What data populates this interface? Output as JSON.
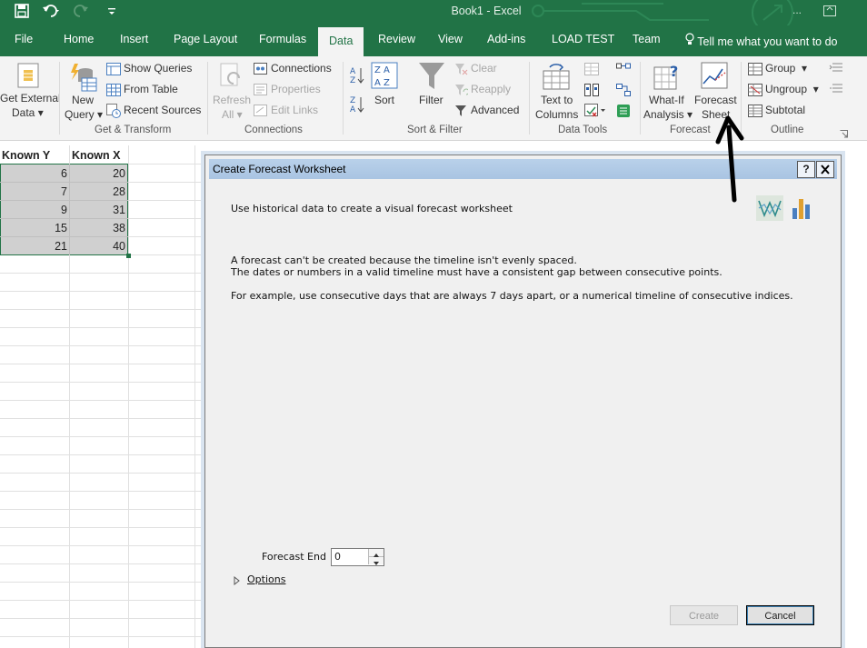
{
  "window": {
    "title": "Book1  -  Excel",
    "more": "..."
  },
  "tabs": [
    {
      "label": "File"
    },
    {
      "label": "Home"
    },
    {
      "label": "Insert"
    },
    {
      "label": "Page Layout"
    },
    {
      "label": "Formulas"
    },
    {
      "label": "Data"
    },
    {
      "label": "Review"
    },
    {
      "label": "View"
    },
    {
      "label": "Add-ins"
    },
    {
      "label": "LOAD TEST"
    },
    {
      "label": "Team"
    }
  ],
  "tell_me": "Tell me what you want to do",
  "ribbon": {
    "get_external": {
      "line1": "Get External",
      "line2": "Data"
    },
    "new_query": {
      "line1": "New",
      "line2": "Query"
    },
    "show_queries": "Show Queries",
    "from_table": "From Table",
    "recent_sources": "Recent Sources",
    "group_get_transform": "Get & Transform",
    "refresh": {
      "line1": "Refresh",
      "line2": "All"
    },
    "connections": "Connections",
    "properties": "Properties",
    "edit_links": "Edit Links",
    "group_connections": "Connections",
    "sort": "Sort",
    "filter": "Filter",
    "clear": "Clear",
    "reapply": "Reapply",
    "advanced": "Advanced",
    "group_sort_filter": "Sort & Filter",
    "text_to_columns": {
      "line1": "Text to",
      "line2": "Columns"
    },
    "group_data_tools": "Data Tools",
    "what_if": {
      "line1": "What-If",
      "line2": "Analysis"
    },
    "forecast_sheet": {
      "line1": "Forecast",
      "line2": "Sheet"
    },
    "group_forecast": "Forecast",
    "group_btn": "Group",
    "ungroup_btn": "Ungroup",
    "subtotal": "Subtotal",
    "group_outline": "Outline"
  },
  "sheet": {
    "headers": [
      "Known Y",
      "Known X"
    ],
    "rows": [
      [
        "6",
        "20"
      ],
      [
        "7",
        "28"
      ],
      [
        "9",
        "31"
      ],
      [
        "15",
        "38"
      ],
      [
        "21",
        "40"
      ]
    ]
  },
  "dialog": {
    "title": "Create Forecast Worksheet",
    "help": "?",
    "intro": "Use historical data to create a visual forecast worksheet",
    "error1": "A forecast can't be created because the timeline isn't evenly spaced.",
    "error2": "The dates or numbers in a valid timeline must have a consistent gap between consecutive points.",
    "example": "For example, use consecutive days that are always 7 days apart, or a numerical timeline of consecutive indices.",
    "forecast_end_label": "Forecast End",
    "forecast_end_value": "0",
    "options": "Options",
    "create": "Create",
    "cancel": "Cancel"
  }
}
